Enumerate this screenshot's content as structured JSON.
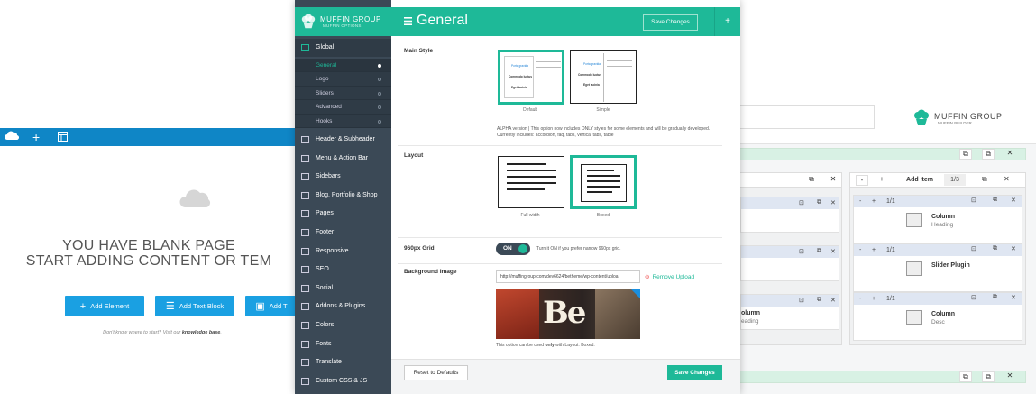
{
  "left_builder": {
    "toolbar_icons": [
      "cloud-icon",
      "plus-icon",
      "layout-icon"
    ],
    "blank_line1": "YOU HAVE BLANK PAGE",
    "blank_line2": "START ADDING CONTENT OR TEM",
    "buttons": [
      {
        "label": "Add Element",
        "icon": "plus-icon"
      },
      {
        "label": "Add Text Block",
        "icon": "text-icon"
      },
      {
        "label": "Add T",
        "icon": "layout-icon"
      }
    ],
    "hint_prefix": "Don't know where to start? Visit our",
    "hint_link": "knowledge base",
    "hint_suffix": "."
  },
  "right_builder": {
    "logo_title": "MUFFIN GROUP",
    "logo_subtitle": "MUFFIN BUILDER",
    "wrap_buttons": {
      "minus": "-",
      "plus": "+",
      "add_item": "Add Item",
      "size": "1/3"
    },
    "items_left": [
      {
        "name": "olumn",
        "sub": "eading"
      }
    ],
    "items_right": [
      {
        "size": "1/1",
        "name": "Column",
        "sub": "Heading",
        "icon": "column-icon"
      },
      {
        "size": "1/1",
        "name": "Slider Plugin",
        "sub": "",
        "icon": "slider-icon"
      },
      {
        "size": "1/1",
        "name": "Column",
        "sub": "Desc",
        "icon": "column-icon"
      }
    ],
    "accent": "#1eb998",
    "item_head_color": "#dfe6f2"
  },
  "panel": {
    "brand_title": "MUFFIN GROUP",
    "brand_subtitle": "MUFFIN OPTIONS",
    "page_title": "General",
    "save_top": "Save Changes",
    "plus": "+",
    "nav_global": "Global",
    "nav_sub": [
      "General",
      "Logo",
      "Sliders",
      "Advanced",
      "Hooks"
    ],
    "nav": [
      "Header & Subheader",
      "Menu & Action Bar",
      "Sidebars",
      "Blog, Portfolio & Shop",
      "Pages",
      "Footer",
      "Responsive",
      "SEO",
      "Social",
      "Addons & Plugins",
      "Colors",
      "Fonts",
      "Translate",
      "Custom CSS & JS"
    ],
    "main_style_label": "Main Style",
    "style_options": [
      {
        "caption": "Default",
        "lines": [
          "Porta gravida",
          "Commodo luctus",
          "Eget lacinia"
        ]
      },
      {
        "caption": "Simple",
        "lines": [
          "Porta gravida",
          "Commodo luctus",
          "Eget lacinia"
        ]
      }
    ],
    "style_note": "ALPHA version | This option now includes ONLY styles for some elements and will be gradually developed. Currently includes: accordion, faq, tabs, vertical tabs, table",
    "layout_label": "Layout",
    "layout_options": [
      "Full width",
      "Boxed"
    ],
    "grid_label": "960px Grid",
    "grid_toggle": "ON",
    "grid_note": "Turn it ON if you prefer narrow 960px grid.",
    "bg_label": "Background Image",
    "bg_url": "http://muffingroup.com/dev6624/betheme/wp-content/uploa",
    "remove_upload": "Remove Upload",
    "bg_note_a": "This option can be used ",
    "bg_note_b": "only",
    "bg_note_c": " with Layout: Boxed.",
    "reset": "Reset to Defaults",
    "save_bottom": "Save Changes",
    "sidebar_bg": "#3b4956",
    "accent": "#1eb998"
  }
}
